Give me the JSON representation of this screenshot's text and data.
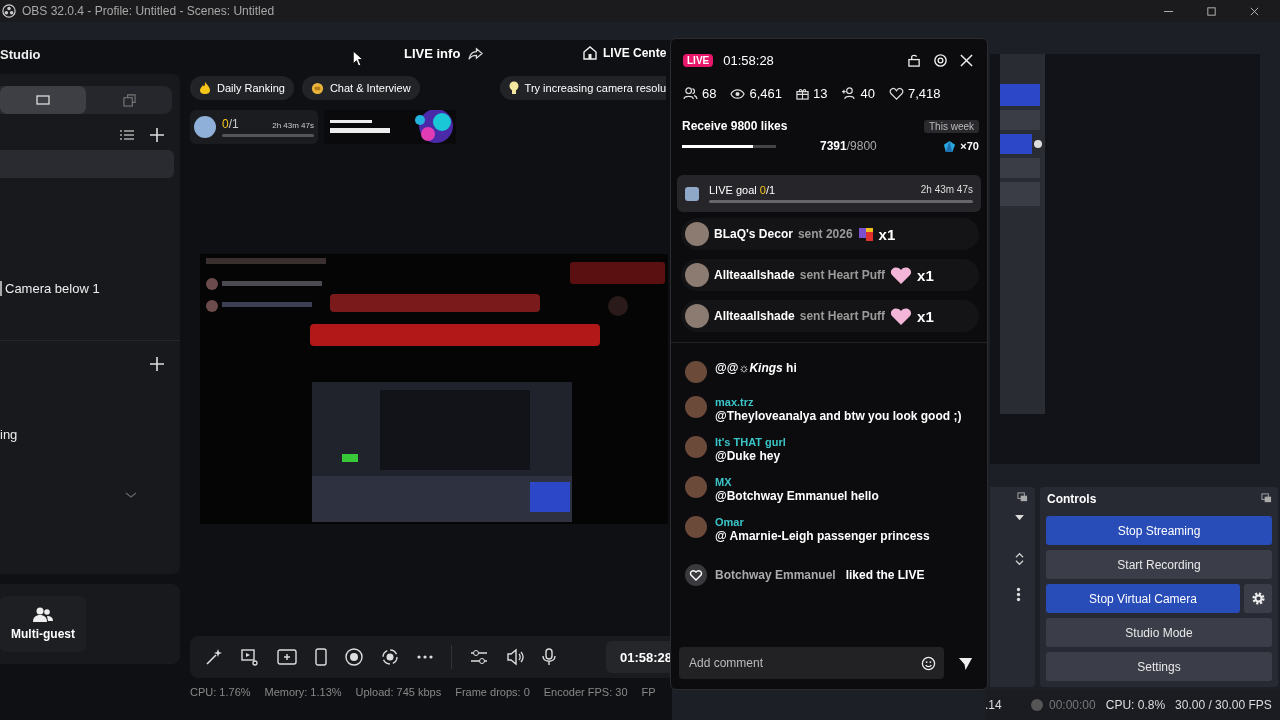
{
  "obs": {
    "title": "OBS 32.0.4 - Profile: Untitled - Scenes: Untitled",
    "controls": {
      "title": "Controls",
      "buttons": [
        {
          "label": "Stop Streaming",
          "active": true
        },
        {
          "label": "Start Recording",
          "active": false
        },
        {
          "label": "Stop Virtual Camera",
          "active": true
        },
        {
          "label": "Studio Mode",
          "active": false
        },
        {
          "label": "Settings",
          "active": false
        }
      ]
    },
    "status": {
      "fragment": ".14",
      "rec_time": "00:00:00",
      "cpu": "CPU: 0.8%",
      "fps": "30.00 / 30.00 FPS"
    }
  },
  "studio": {
    "brand": "Studio",
    "header": [
      "LIVE info",
      "LIVE Cente"
    ],
    "view_tabs": [
      {
        "selected": true
      },
      {
        "selected": false
      }
    ],
    "sidebar_items": [
      "Camera below 1",
      "ing"
    ],
    "multi_guest": "Multi-guest",
    "chips": [
      "Daily Ranking",
      "Chat & Interview"
    ],
    "tip": "Try increasing camera resolu",
    "goal_card": {
      "done": "0",
      "total": "/1",
      "time": "2h 43m 47s",
      "level": 0
    },
    "timer": "01:58:28",
    "stats": [
      "CPU: 1.76%",
      "Memory: 1.13%",
      "Upload: 745 kbps",
      "Frame drops: 0",
      "Encoder FPS: 30",
      "FP"
    ]
  },
  "overlay": {
    "live_badge": "LIVE",
    "timer": "01:58:28",
    "stats": [
      "68",
      "6,461",
      "13",
      "40",
      "7,418"
    ],
    "weekly_goal": {
      "title": "Receive 9800 likes",
      "period": "This week",
      "progress": "**7391**/9800",
      "reward": "×70",
      "level": 0.75
    },
    "live_goal": {
      "label": "LIVE goal",
      "done": "0",
      "total": "/1",
      "time": "2h 43m 47s",
      "level": 0
    },
    "gifts": [
      {
        "user": "BLaQ's Decor",
        "action": "sent 2026",
        "count": "x1"
      },
      {
        "user": "Allteaallshade",
        "action": "sent Heart Puff",
        "count": "x1"
      },
      {
        "user": "Allteaallshade",
        "action": "sent Heart Puff",
        "count": "x1"
      }
    ],
    "messages": [
      {
        "text": "@@☼*Kings* hi"
      },
      {
        "user": "max.trz",
        "text": "@Theyloveanalya and btw you look good ;)"
      },
      {
        "user": "It's THAT gurl",
        "text": "@Duke hey"
      },
      {
        "user": "MX",
        "text": "@Botchway Emmanuel hello"
      },
      {
        "user": "Omar",
        "text": "@ Amarnie-Leigh passenger princess"
      }
    ],
    "like": {
      "user": "Botchway Emmanuel",
      "action": "liked the LIVE"
    },
    "comment": {
      "placeholder": "Add comment"
    }
  }
}
